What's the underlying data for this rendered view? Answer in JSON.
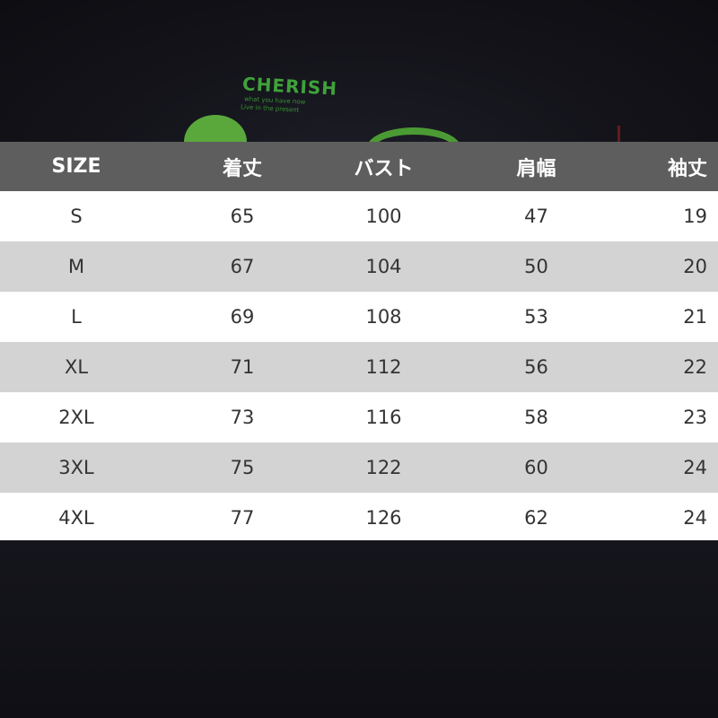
{
  "background_print": {
    "title": "CHERISH",
    "line1": "what you have now",
    "line2": "Live in the present"
  },
  "table": {
    "headers": [
      "SIZE",
      "着丈",
      "バスト",
      "肩幅",
      "袖丈"
    ],
    "rows": [
      [
        "S",
        "65",
        "100",
        "47",
        "19"
      ],
      [
        "M",
        "67",
        "104",
        "50",
        "20"
      ],
      [
        "L",
        "69",
        "108",
        "53",
        "21"
      ],
      [
        "XL",
        "71",
        "112",
        "56",
        "22"
      ],
      [
        "2XL",
        "73",
        "116",
        "58",
        "23"
      ],
      [
        "3XL",
        "75",
        "122",
        "60",
        "24"
      ],
      [
        "4XL",
        "77",
        "126",
        "62",
        "24"
      ]
    ]
  },
  "colors": {
    "header_bg": "#5e5e5e",
    "row_white": "#ffffff",
    "row_gray": "#d3d3d3",
    "print_green": "#3fa23a",
    "shirt_dark": "#121219"
  }
}
